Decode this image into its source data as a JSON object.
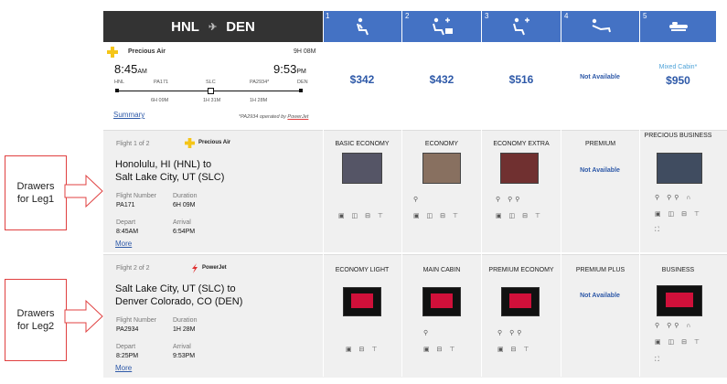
{
  "route": {
    "from": "HNL",
    "to": "DEN",
    "plane_glyph": "✈"
  },
  "cabins_header": [
    {
      "num": "1",
      "icon": "seat-icon"
    },
    {
      "num": "2",
      "icon": "seat-plus-icon"
    },
    {
      "num": "3",
      "icon": "seat-plus-icon"
    },
    {
      "num": "4",
      "icon": "recline-seat-icon"
    },
    {
      "num": "5",
      "icon": "flat-bed-icon"
    }
  ],
  "summary": {
    "airline": "Precious Air",
    "total_duration": "9H 08M",
    "depart_time": "8:45",
    "depart_ampm": "AM",
    "arrive_time": "9:53",
    "arrive_ampm": "PM",
    "stops": [
      "HNL",
      "PA171",
      "SLC",
      "PA2934*",
      "DEN"
    ],
    "segment_durations": [
      "6H 09M",
      "1H 31M",
      "1H 28M"
    ],
    "summary_link": "Summary",
    "operated_note": "*PA2934 operated by ",
    "operated_by": "PowerJet"
  },
  "prices": [
    {
      "value": "$342"
    },
    {
      "value": "$432"
    },
    {
      "value": "$516"
    },
    {
      "value": "Not Available"
    },
    {
      "value": "$950",
      "note": "Mixed Cabin*"
    }
  ],
  "callouts": [
    {
      "text": "Drawers for Leg1"
    },
    {
      "text": "Drawers for Leg2"
    }
  ],
  "legs": [
    {
      "flight_label": "Flight 1 of 2",
      "airline": "Precious Air",
      "route_line1": "Honolulu, HI (HNL) to",
      "route_line2": "Salt Lake City, UT (SLC)",
      "flight_number_label": "Flight Number",
      "flight_number": "PA171",
      "duration_label": "Duration",
      "duration": "6H 09M",
      "depart_label": "Depart",
      "depart": "8:45AM",
      "arrival_label": "Arrival",
      "arrival": "6:54PM",
      "more": "More",
      "cabins": [
        {
          "name": "BASIC ECONOMY",
          "na": false
        },
        {
          "name": "ECONOMY",
          "na": false
        },
        {
          "name": "ECONOMY EXTRA",
          "na": false
        },
        {
          "name": "PREMIUM",
          "na": true,
          "na_text": "Not Available"
        },
        {
          "name": "PRECIOUS BUSINESS",
          "na": false
        }
      ]
    },
    {
      "flight_label": "Flight 2 of 2",
      "airline": "PowerJet",
      "route_line1": "Salt Lake City, UT (SLC) to",
      "route_line2": "Denver Colorado, CO (DEN)",
      "flight_number_label": "Flight Number",
      "flight_number": "PA2934",
      "duration_label": "Duration",
      "duration": "1H 28M",
      "depart_label": "Depart",
      "depart": "8:25PM",
      "arrival_label": "Arrival",
      "arrival": "9:53PM",
      "more": "More",
      "cabins": [
        {
          "name": "ECONOMY LIGHT",
          "na": false
        },
        {
          "name": "MAIN CABIN",
          "na": false
        },
        {
          "name": "PREMIUM ECONOMY",
          "na": false
        },
        {
          "name": "PREMIUM PLUS",
          "na": true,
          "na_text": "Not Available"
        },
        {
          "name": "BUSINESS",
          "na": false
        }
      ]
    }
  ],
  "colors": {
    "header_dark": "#333333",
    "header_blue": "#4472c4",
    "price_blue": "#2e59a8",
    "callout_red": "#e04040"
  }
}
